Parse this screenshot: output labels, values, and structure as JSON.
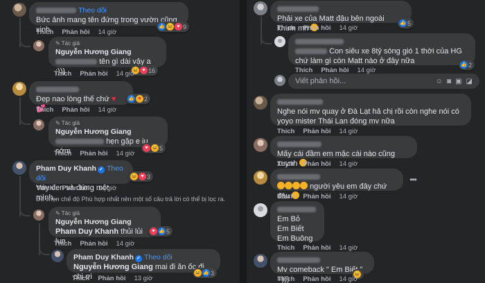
{
  "labels": {
    "like": "Thích",
    "reply": "Phản hồi",
    "follow": "Theo dõi",
    "author": "Tác giả"
  },
  "left": {
    "c1": {
      "text": "Bức ảnh mang tên đứng trong vườn cũng xinh",
      "time": "14 giờ",
      "reacts": "9"
    },
    "c1r": {
      "name": "Nguyễn Hương Giang",
      "text": "tên gì dài vậy a :)))",
      "time": "14 giờ",
      "reacts": "16"
    },
    "c2": {
      "text": "Đẹp nao lòng thế chứ",
      "time": "14 giờ",
      "reacts": "2"
    },
    "c2r": {
      "name": "Nguyễn Hương Giang",
      "text": "hẹn gặp e iu sớm",
      "time": "14 giờ",
      "reacts": "5"
    },
    "c3": {
      "name": "Pham Duy Khanh",
      "text": "Váy đen và đứng một mình...",
      "time": "14 giờ",
      "reacts": "3"
    },
    "note": "Đã chọn chế độ Phù hợp nhất nên một số câu trả lời có thể bị lọc ra.",
    "c3r": {
      "name": "Nguyễn Hương Giang",
      "mention": "Pham Duy Khanh",
      "text": " thủi lủi lun",
      "time": "14 giờ",
      "reacts": "5"
    },
    "c3r2": {
      "name": "Pham Duy Khanh",
      "mention": "Nguyễn Hương Giang",
      "text": " mai đi ăn ốc đi chị ơi",
      "time": "13 giờ",
      "reacts": "3"
    }
  },
  "right": {
    "r1": {
      "text": "Phải xe của Matt đậu bên ngoài khum mn",
      "time": "14 giờ",
      "reacts": "5"
    },
    "r1r": {
      "text": "Con siêu xe 8tỷ sóng gió 1 thời của HG chứ làm gì còn Matt nào ở đây nữa",
      "time": "14 giờ",
      "reacts": "2"
    },
    "reply_placeholder": "Viết phản hồi...",
    "r2": {
      "text": "Nghe nói mv quay ở Đà Lạt hả chị rồi còn nghe nói có yoyo mister Thái Lan đóng mv nữa",
      "time": "14 giờ"
    },
    "r3": {
      "text": "Mấy cái đầm em mặc cái nào cũng xuynh",
      "time": "14 giờ"
    },
    "r4": {
      "text": "người yêu em đây chứ đâu",
      "time": "14 giờ"
    },
    "r5": {
      "lines": [
        "Em Bỏ",
        "Em Biết",
        "Em Buông"
      ],
      "time": "14 giờ"
    },
    "r6": {
      "text": "Mv comeback \" Em Biết \" =)))",
      "time": "14 giờ"
    }
  }
}
